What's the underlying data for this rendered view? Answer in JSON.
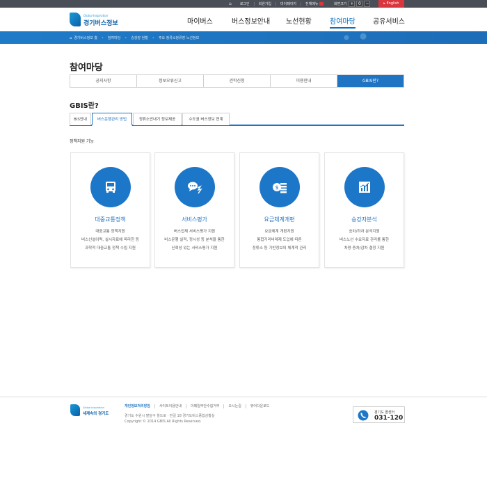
{
  "topbar": {
    "links": [
      "로그인",
      "회원가입",
      "마이페이지",
      "전체메뉴"
    ],
    "font_size_label": "화면크기",
    "font_controls": [
      "+",
      "0",
      "−"
    ],
    "english": "English"
  },
  "logo": {
    "small": "Global Inspiration",
    "main": "경기버스정보"
  },
  "gnb": [
    "마이버스",
    "버스정보안내",
    "노선현황",
    "참여마당",
    "공유서비스"
  ],
  "breadcrumb": [
    "경기버스정보 홈",
    "참여마당",
    "승강장 현황",
    "주요 정류소정류장 노선정보"
  ],
  "page_title": "참여마당",
  "main_tabs": [
    "공지사항",
    "정보오류신고",
    "견학신청",
    "이용안내",
    "GBIS란?"
  ],
  "section_title": "GBIS란?",
  "sub_tabs": [
    "BIS안내",
    "버스운행관리 방법",
    "정류소안내기 정보제공",
    "수도권 버스정보 연계"
  ],
  "group_heading": "정책지원 기능",
  "cards": [
    {
      "icon": "bus-icon",
      "title": "대중교통정책",
      "lines": [
        "대중교통 정책지원",
        "버스신설이력, 실시자료에 따라한 등",
        "과학적 대중교통 정책 수립 지원"
      ]
    },
    {
      "icon": "chat-icon",
      "title": "서비스평가",
      "lines": [
        "버스업체 서비스평가 지원",
        "버스운행 실적, 정시성 등 분석을 통한",
        "신뢰성 있는 서비스평가 지원"
      ]
    },
    {
      "icon": "money-icon",
      "title": "요금체계개편",
      "lines": [
        "요금체계 개편지원",
        "통합거리비례제 도입에 따른",
        "정류소 등 기반정보의 체계적 관리"
      ]
    },
    {
      "icon": "chart-icon",
      "title": "승강자분석",
      "lines": [
        "승차/하차 분석지원",
        "버스노선 수요자료 관리를 통한",
        "차량 증차/감차 결정 지원"
      ]
    }
  ],
  "footer": {
    "logo_small": "Global Inspiration",
    "logo_main": "세계속의 경기도",
    "links": [
      "개인정보처리방침",
      "사이트이용안내",
      "이메일무단수집거부",
      "오시는길",
      "뷰어다운로드"
    ],
    "address": "경기도 수원시 팔달구 월드로 · 번길 18 경기도버스종합상황실",
    "copyright": "Copyright © 2014 GBIS All Rights Reserved.",
    "call_label": "경기도 콜센터",
    "call_number": "031-120"
  }
}
